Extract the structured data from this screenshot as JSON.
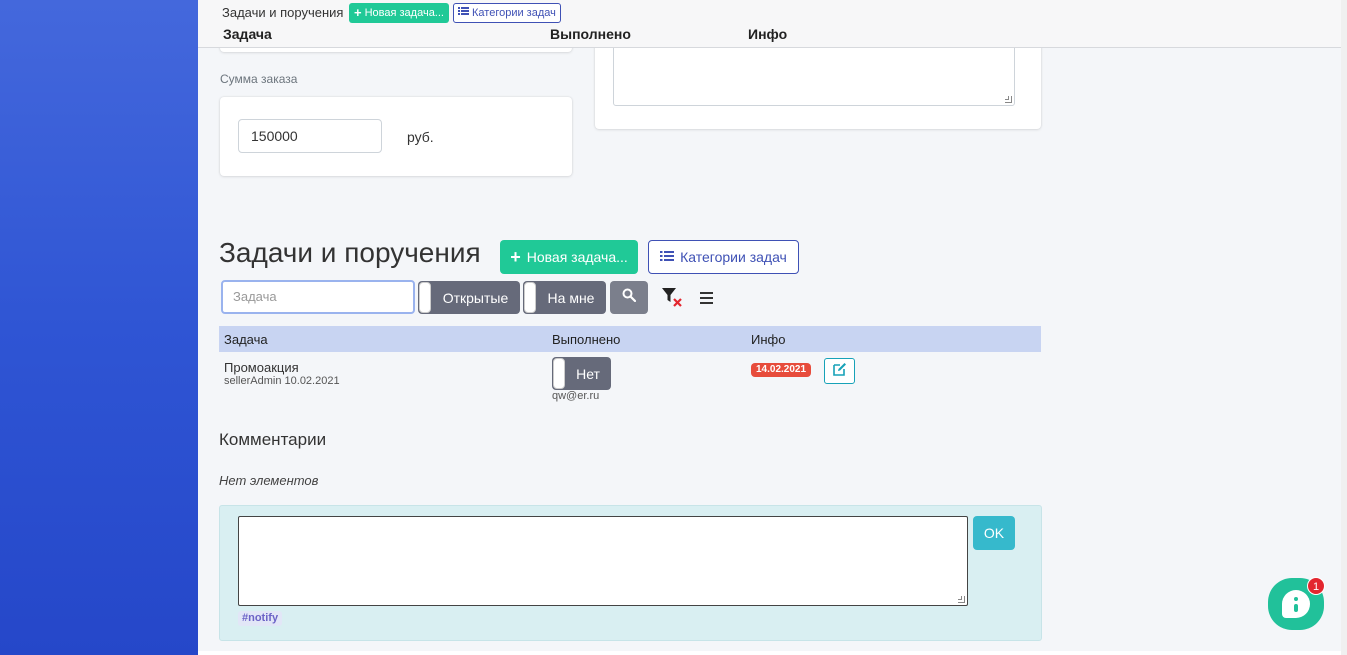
{
  "sticky_header": {
    "title": "Задачи и поручения",
    "new_task_label": "Новая задача...",
    "categories_label": "Категории задач",
    "col_task": "Задача",
    "col_done": "Выполнено",
    "col_info": "Инфо"
  },
  "order_sum": {
    "label": "Сумма заказа",
    "value": "150000",
    "unit": "руб."
  },
  "tasks": {
    "title": "Задачи и поручения",
    "new_task_label": "Новая задача...",
    "categories_label": "Категории задач",
    "search_placeholder": "Задача",
    "toggle_open": "Открытые",
    "toggle_mine": "На мне",
    "table": {
      "headers": [
        "Задача",
        "Выполнено",
        "Инфо"
      ],
      "rows": [
        {
          "title": "Промоакция",
          "author": "sellerAdmin 10.02.2021",
          "done": "Нет",
          "assignee": "qw@er.ru",
          "due": "14.02.2021"
        }
      ]
    }
  },
  "comments": {
    "title": "Комментарии",
    "empty": "Нет элементов",
    "ok_label": "OK",
    "tag": "#notify"
  },
  "chat": {
    "badge_count": "1"
  },
  "colors": {
    "sidebar": "#3558d6",
    "success": "#20c997",
    "primary_outline": "#3f51b5",
    "danger": "#e74c3c",
    "info": "#36b9cc"
  }
}
